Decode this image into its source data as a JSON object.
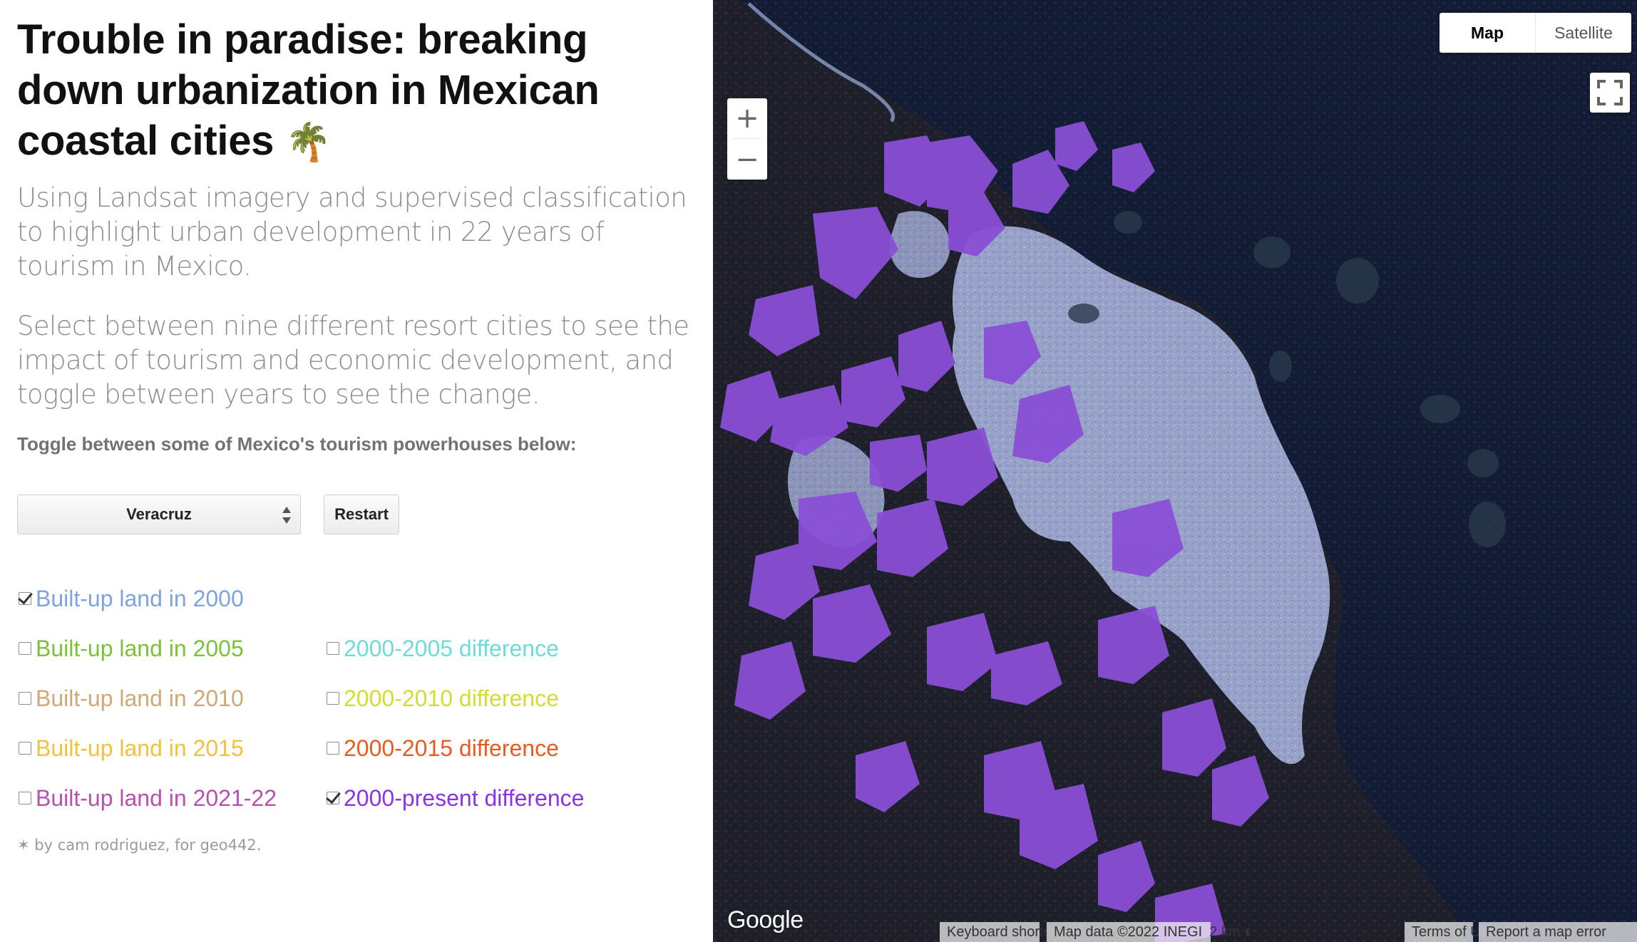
{
  "panel": {
    "title": "Trouble in paradise: breaking down urbanization in Mexican coastal cities",
    "title_emoji": "🌴",
    "lead": "Using Landsat imagery and supervised classification to highlight urban development in 22 years of tourism in Mexico.",
    "lead2": "Select between nine different resort cities to see the impact of tourism and economic development, and toggle between years to see the change.",
    "prompt": "Toggle between some of Mexico's tourism powerhouses below:",
    "city_select": {
      "value": "Veracruz"
    },
    "restart_label": "Restart",
    "credit": "✶ by cam rodriguez, for geo442."
  },
  "layers": [
    {
      "label": "Built-up land in 2000",
      "color": "#7fa3e0",
      "checked": true
    },
    {
      "label": "Built-up land in 2005",
      "color": "#7cc13a",
      "checked": false
    },
    {
      "label": "Built-up land in 2010",
      "color": "#d0a877",
      "checked": false
    },
    {
      "label": "Built-up land in 2015",
      "color": "#f2c23c",
      "checked": false
    },
    {
      "label": "Built-up land in 2021-22",
      "color": "#b94fb1",
      "checked": false
    },
    {
      "label": "2000-2005 difference",
      "color": "#6fdbd8",
      "checked": false
    },
    {
      "label": "2000-2010 difference",
      "color": "#d4dc2e",
      "checked": false
    },
    {
      "label": "2000-2015 difference",
      "color": "#ea5a1e",
      "checked": false
    },
    {
      "label": "2000-present difference",
      "color": "#8a34e6",
      "checked": true
    }
  ],
  "map": {
    "type_control": {
      "map": "Map",
      "satellite": "Satellite",
      "active": "Map"
    },
    "zoom_in": "+",
    "zoom_out": "−",
    "logo": "Google",
    "attribution": {
      "shortcuts": "Keyboard shortcuts",
      "data": "Map data ©2022 INEGI",
      "scale": "2 km",
      "terms": "Terms of Use",
      "report": "Report a map error"
    },
    "colors": {
      "sea": "#121c33",
      "land": "#1d2028",
      "urban_2000": "#9aa6cc",
      "growth": "#8a4fd6"
    }
  }
}
